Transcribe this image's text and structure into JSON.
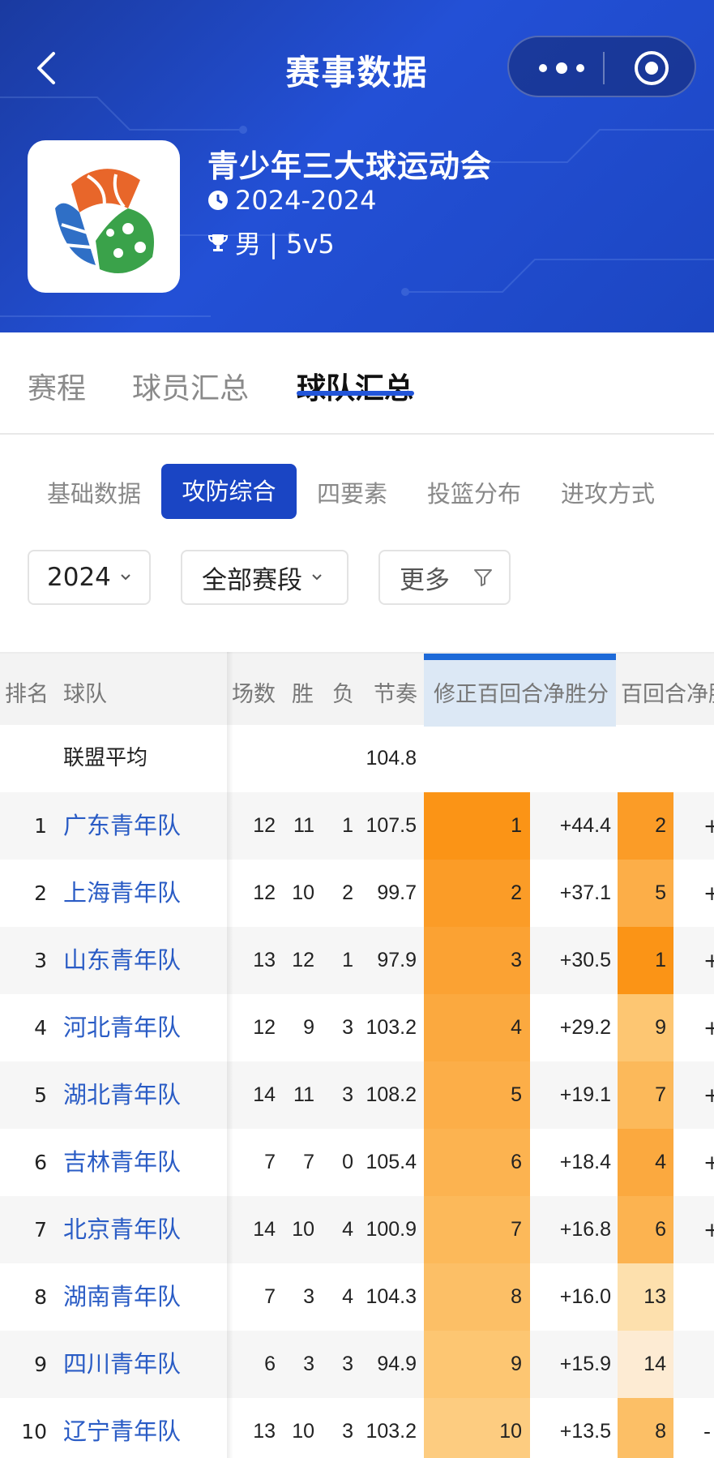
{
  "header": {
    "title": "赛事数据",
    "event_name": "青少年三大球运动会",
    "event_date": "2024-2024",
    "event_type": "男 | 5v5"
  },
  "main_tabs": [
    "赛程",
    "球员汇总",
    "球队汇总"
  ],
  "active_main_tab": 2,
  "sub_tabs": [
    "基础数据",
    "攻防综合",
    "四要素",
    "投篮分布",
    "进攻方式"
  ],
  "active_sub_tab": 1,
  "filters": {
    "season": "2024",
    "stage": "全部赛段",
    "more": "更多"
  },
  "table": {
    "headers": [
      "排名",
      "球队",
      "场数",
      "胜",
      "负",
      "节奏",
      "修正百回合净胜分",
      "百回合净胜"
    ],
    "league_avg_label": "联盟平均",
    "league_avg_pace": "104.8",
    "rows": [
      {
        "rank": "1",
        "team": "广东青年队",
        "games": "12",
        "wins": "11",
        "losses": "1",
        "pace": "107.5",
        "adj_rank": "1",
        "adj_net": "+44.4",
        "net_rank": "2",
        "net_trunc": "+"
      },
      {
        "rank": "2",
        "team": "上海青年队",
        "games": "12",
        "wins": "10",
        "losses": "2",
        "pace": "99.7",
        "adj_rank": "2",
        "adj_net": "+37.1",
        "net_rank": "5",
        "net_trunc": "+"
      },
      {
        "rank": "3",
        "team": "山东青年队",
        "games": "13",
        "wins": "12",
        "losses": "1",
        "pace": "97.9",
        "adj_rank": "3",
        "adj_net": "+30.5",
        "net_rank": "1",
        "net_trunc": "+"
      },
      {
        "rank": "4",
        "team": "河北青年队",
        "games": "12",
        "wins": "9",
        "losses": "3",
        "pace": "103.2",
        "adj_rank": "4",
        "adj_net": "+29.2",
        "net_rank": "9",
        "net_trunc": "+"
      },
      {
        "rank": "5",
        "team": "湖北青年队",
        "games": "14",
        "wins": "11",
        "losses": "3",
        "pace": "108.2",
        "adj_rank": "5",
        "adj_net": "+19.1",
        "net_rank": "7",
        "net_trunc": "+"
      },
      {
        "rank": "6",
        "team": "吉林青年队",
        "games": "7",
        "wins": "7",
        "losses": "0",
        "pace": "105.4",
        "adj_rank": "6",
        "adj_net": "+18.4",
        "net_rank": "4",
        "net_trunc": "+"
      },
      {
        "rank": "7",
        "team": "北京青年队",
        "games": "14",
        "wins": "10",
        "losses": "4",
        "pace": "100.9",
        "adj_rank": "7",
        "adj_net": "+16.8",
        "net_rank": "6",
        "net_trunc": "+"
      },
      {
        "rank": "8",
        "team": "湖南青年队",
        "games": "7",
        "wins": "3",
        "losses": "4",
        "pace": "104.3",
        "adj_rank": "8",
        "adj_net": "+16.0",
        "net_rank": "13",
        "net_trunc": ""
      },
      {
        "rank": "9",
        "team": "四川青年队",
        "games": "6",
        "wins": "3",
        "losses": "3",
        "pace": "94.9",
        "adj_rank": "9",
        "adj_net": "+15.9",
        "net_rank": "14",
        "net_trunc": ""
      },
      {
        "rank": "10",
        "team": "辽宁青年队",
        "games": "13",
        "wins": "10",
        "losses": "3",
        "pace": "103.2",
        "adj_rank": "10",
        "adj_net": "+13.5",
        "net_rank": "8",
        "net_trunc": "-"
      }
    ]
  },
  "colors": {
    "header_blue": "#1c46c2",
    "active_tab_blue": "#1a45c4",
    "team_link": "#2a5cc5",
    "heat_max": "#fb9416",
    "heat_min": "#fdebd3"
  }
}
